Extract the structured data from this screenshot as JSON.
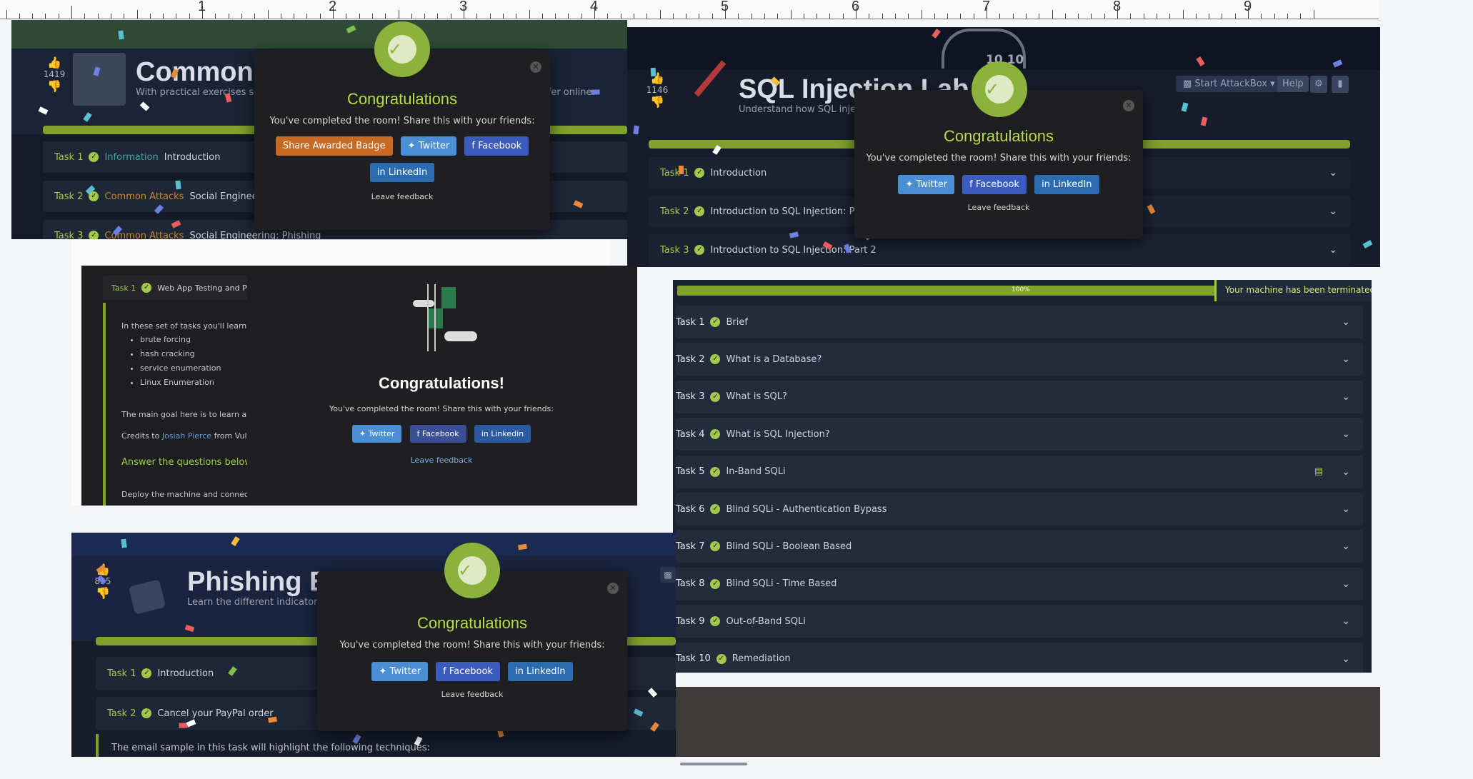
{
  "ruler": {
    "numbers": [
      "1",
      "2",
      "3",
      "4",
      "5",
      "6",
      "7",
      "8",
      "9"
    ]
  },
  "p1": {
    "likes": "1419",
    "title": "Common A",
    "subtitle": "With practical exercises see",
    "subtitle_tail": "safer online.",
    "tasks": [
      {
        "num": "Task 1",
        "tag": "Information",
        "title": "Introduction"
      },
      {
        "num": "Task 2",
        "tag": "Common Attacks",
        "title": "Social Engineeri"
      },
      {
        "num": "Task 3",
        "tag": "Common Attacks",
        "title": "Social Engineering: Phishing"
      }
    ],
    "modal": {
      "heading": "Congratulations",
      "text": "You've completed the room! Share this with your friends:",
      "share_badge": "Share Awarded Badge",
      "twitter": "Twitter",
      "facebook": "Facebook",
      "linkedin": "LinkedIn",
      "feedback": "Leave feedback"
    }
  },
  "p2": {
    "likes": "1146",
    "title": "SQL Injection Lab",
    "subtitle": "Understand how SQL injecti",
    "cloud_text": "10 10",
    "attackbox": "Start AttackBox",
    "help": "Help",
    "tasks": [
      {
        "num": "Task 1",
        "title": "Introduction"
      },
      {
        "num": "Task 2",
        "title": "Introduction to SQL Injection: Part 1"
      },
      {
        "num": "Task 3",
        "title": "Introduction to SQL Injection: Part 2"
      }
    ],
    "modal": {
      "heading": "Congratulations",
      "text": "You've completed the room! Share this with your friends:",
      "twitter": "Twitter",
      "facebook": "Facebook",
      "linkedin": "LinkedIn",
      "feedback": "Leave feedback"
    }
  },
  "p3": {
    "task": {
      "num": "Task 1",
      "title": "Web App Testing and Priv"
    },
    "intro": "In these set of tasks you'll learn the",
    "bullets": [
      "brute forcing",
      "hash cracking",
      "service enumeration",
      "Linux Enumeration"
    ],
    "goal": "The main goal here is to learn as mu",
    "credits_prefix": "Credits to",
    "credits_name": "Josiah Pierce",
    "credits_suffix": "from Vulnh",
    "answer": "Answer the questions below",
    "deploy": "Deploy the machine and connect to",
    "close": "×",
    "modal": {
      "heading": "Congratulations!",
      "text": "You've completed the room! Share this with your friends:",
      "twitter": "Twitter",
      "facebook": "Facebook",
      "linkedin": "Linkedin",
      "feedback": "Leave feedback"
    }
  },
  "p4": {
    "progress_label": "100%",
    "progress": 1.0,
    "terminated": "Your machine has been terminated.",
    "tasks": [
      {
        "num": "Task 1",
        "title": "Brief"
      },
      {
        "num": "Task 2",
        "title": "What is a Database?"
      },
      {
        "num": "Task 3",
        "title": "What is SQL?"
      },
      {
        "num": "Task 4",
        "title": "What is SQL Injection?"
      },
      {
        "num": "Task 5",
        "title": "In-Band SQLi"
      },
      {
        "num": "Task 6",
        "title": "Blind SQLi - Authentication Bypass"
      },
      {
        "num": "Task 7",
        "title": "Blind SQLi - Boolean Based"
      },
      {
        "num": "Task 8",
        "title": "Blind SQLi - Time Based"
      },
      {
        "num": "Task 9",
        "title": "Out-of-Band SQLi"
      },
      {
        "num": "Task 10",
        "title": "Remediation"
      }
    ]
  },
  "p5": {
    "likes": "895",
    "title": "Phishing Em",
    "subtitle": "Learn the different indicators",
    "tasks": [
      {
        "num": "Task 1",
        "title": "Introduction"
      },
      {
        "num": "Task 2",
        "title": "Cancel your PayPal order"
      }
    ],
    "body": "The email sample in this task will highlight the following techniques:",
    "modal": {
      "heading": "Congratulations",
      "text": "You've completed the room! Share this with your friends:",
      "twitter": "Twitter",
      "facebook": "Facebook",
      "linkedin": "LinkedIn",
      "feedback": "Leave feedback"
    }
  },
  "colors": {
    "accent_green": "#a3c94a",
    "panel_bg": "#1b2232",
    "modal_bg": "#1f1f21",
    "twitter": "#4a8fd6",
    "facebook": "#3b5bbf",
    "share_badge": "#c66a25"
  }
}
